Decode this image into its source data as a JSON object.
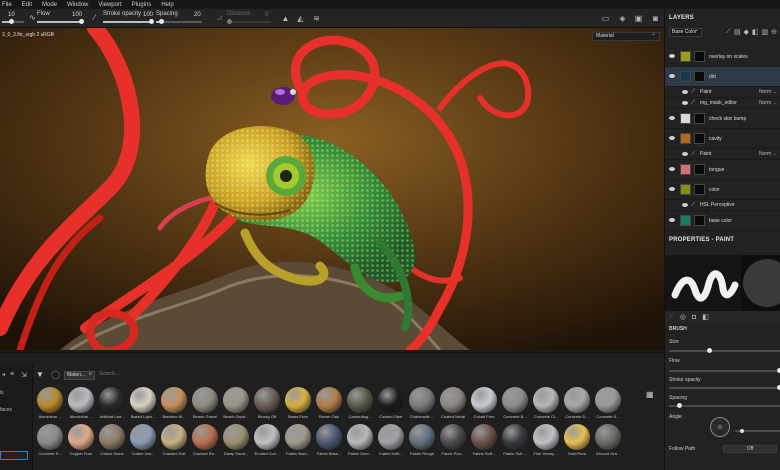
{
  "menu": [
    "File",
    "Edit",
    "Mode",
    "Window",
    "Viewport",
    "Plugins",
    "Help"
  ],
  "toolbar": {
    "size_value": "10",
    "flow_label": "Flow",
    "flow_value": "100",
    "stroke_opacity_label": "Stroke opacity",
    "stroke_opacity_value": "100",
    "spacing_label": "Spacing",
    "spacing_value": "20",
    "distance_label": "Distance",
    "distance_value": "0"
  },
  "viewport": {
    "caption": "3_0_3.fin_srgb 2 sRGB",
    "display_channel": "Material"
  },
  "layers_panel": {
    "title": "LAYERS",
    "channel": "Base Color",
    "layers": [
      {
        "name": "overlay on scales",
        "thumb_color": "#9e9a1c"
      },
      {
        "name": "dirt",
        "thumb_color": "#1a3a4a",
        "selected": true
      },
      {
        "name": "Paint",
        "sub": true,
        "blend": "Norm"
      },
      {
        "name": "mg_mask_editor",
        "sub": true,
        "blend": "Norm"
      },
      {
        "name": "check skin bump",
        "thumb_color": "#d8d8d8"
      },
      {
        "name": "cavity",
        "thumb_color": "#b4661a"
      },
      {
        "name": "Paint",
        "sub": true,
        "blend": "Norm"
      },
      {
        "name": "tongue",
        "thumb_color": "#d66f6f"
      },
      {
        "name": "color",
        "thumb_color": "#8a8a1a"
      },
      {
        "name": "HSL Perceptive",
        "sub": true
      },
      {
        "name": "base color",
        "thumb_color": "#1a7a6a"
      }
    ]
  },
  "properties": {
    "title": "PROPERTIES - PAINT",
    "brush_label": "BRUSH",
    "size_label": "Size",
    "flow_label": "Flow",
    "stroke_opacity_label": "Stroke opacity",
    "spacing_label": "Spacing",
    "angle_label": "Angle",
    "follow_path_label": "Follow Path",
    "follow_path_value": "Off"
  },
  "shelf": {
    "side_labels": [
      "ls",
      "faces"
    ],
    "filter_chip": "Materi...",
    "search_placeholder": "Search...",
    "materials_row1": [
      {
        "name": "Aluminium ...",
        "color": "#b8892a"
      },
      {
        "name": "Aluminium ...",
        "color": "#b9bcc0"
      },
      {
        "name": "Artificial Lea...",
        "color": "#2a2a2c"
      },
      {
        "name": "Baked Light...",
        "color": "#d9d2c2"
      },
      {
        "name": "Bamboo W...",
        "color": "#c6905a"
      },
      {
        "name": "Beach Gravel",
        "color": "#8e8a80"
      },
      {
        "name": "Beach Sand...",
        "color": "#9a9686"
      },
      {
        "name": "Blocky Off",
        "color": "#6a5c58"
      },
      {
        "name": "Brass Pure",
        "color": "#d8b040"
      },
      {
        "name": "Brown Oak",
        "color": "#b27d48"
      },
      {
        "name": "Camouflag...",
        "color": "#5a5a48"
      },
      {
        "name": "Carbon Fiber",
        "color": "#1c1c1e"
      },
      {
        "name": "Chainmaile ...",
        "color": "#7c7c7c"
      },
      {
        "name": "Coated Metal",
        "color": "#8a8680"
      },
      {
        "name": "Cobalt Pure",
        "color": "#c8ccd0"
      },
      {
        "name": "Concrete B...",
        "color": "#8c8c8a"
      },
      {
        "name": "Concrete Cl...",
        "color": "#b6b6b4"
      },
      {
        "name": "Concrete D...",
        "color": "#a8a8a6"
      },
      {
        "name": "Concrete S...",
        "color": "#9a9a98"
      }
    ],
    "materials_row2": [
      {
        "name": "Concrete S...",
        "color": "#8a8a88"
      },
      {
        "name": "Copper Pure",
        "color": "#e0a88a"
      },
      {
        "name": "Cotton Stone",
        "color": "#8e7a66"
      },
      {
        "name": "Cotton Jea...",
        "color": "#8a9ab0"
      },
      {
        "name": "Cracked Soil",
        "color": "#c8b080"
      },
      {
        "name": "Cracked Ro...",
        "color": "#b87050"
      },
      {
        "name": "Damp Sand...",
        "color": "#9a9070"
      },
      {
        "name": "Eroded Con...",
        "color": "#c0c0c0"
      },
      {
        "name": "Fabric Bam...",
        "color": "#a09a8a"
      },
      {
        "name": "Fabric Base...",
        "color": "#4a5a70"
      },
      {
        "name": "Fabric Deni...",
        "color": "#b8b8b8"
      },
      {
        "name": "Fabric Knitt...",
        "color": "#a0a0a4"
      },
      {
        "name": "Fabric Rough",
        "color": "#607080"
      },
      {
        "name": "Fabric Rou...",
        "color": "#4a4a4e"
      },
      {
        "name": "Fabric Soft...",
        "color": "#6a5248"
      },
      {
        "name": "Fabric Suit ...",
        "color": "#3a3a3e"
      },
      {
        "name": "Fine Jersey ...",
        "color": "#c0c0c4"
      },
      {
        "name": "Gold Pure",
        "color": "#e6c050"
      },
      {
        "name": "Ground Gra...",
        "color": "#6a6a66"
      }
    ]
  },
  "colors": {
    "accent_blue": "#2d7fd0",
    "ribbon_red": "#e8302a",
    "chameleon_green": "#3c9a38",
    "chameleon_yellow": "#e0c030"
  }
}
